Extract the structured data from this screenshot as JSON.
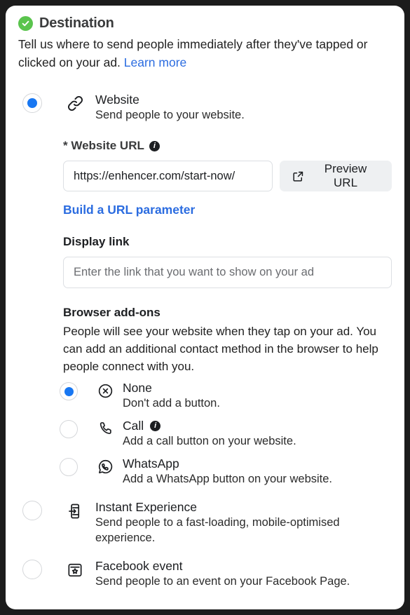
{
  "header": {
    "status_icon": "check-circle-icon",
    "status_color": "#5ac44d",
    "title": "Destination",
    "description": "Tell us where to send people immediately after they've tapped or clicked on your ad. ",
    "learn_more_label": "Learn more",
    "link_color": "#2b6ce0"
  },
  "website_option": {
    "icon": "link-icon",
    "title": "Website",
    "subtitle": "Send people to your website.",
    "selected": true
  },
  "website_url": {
    "label": "* Website URL",
    "info_icon": "info-icon",
    "value": "https://enhencer.com/start-now/",
    "placeholder": "",
    "preview_button_label": "Preview URL",
    "preview_button_icon": "external-link-icon",
    "build_parameter_label": "Build a URL parameter"
  },
  "display_link": {
    "label": "Display link",
    "placeholder": "Enter the link that you want to show on your ad",
    "value": ""
  },
  "browser_addons": {
    "label": "Browser add-ons",
    "description": "People will see your website when they tap on your ad. You can add an additional contact method in the browser to help people connect with you.",
    "options": [
      {
        "icon": "x-circle-icon",
        "title": "None",
        "subtitle": "Don't add a button.",
        "selected": true,
        "has_info": false
      },
      {
        "icon": "phone-icon",
        "title": "Call",
        "subtitle": "Add a call button on your website.",
        "selected": false,
        "has_info": true,
        "info_icon": "info-icon"
      },
      {
        "icon": "whatsapp-icon",
        "title": "WhatsApp",
        "subtitle": "Add a WhatsApp button on your website.",
        "selected": false,
        "has_info": false
      }
    ]
  },
  "other_destinations": [
    {
      "icon": "instant-experience-icon",
      "title": "Instant Experience",
      "subtitle": "Send people to a fast-loading, mobile-optimised experience.",
      "selected": false
    },
    {
      "icon": "facebook-event-icon",
      "title": "Facebook event",
      "subtitle": "Send people to an event on your Facebook Page.",
      "selected": false
    }
  ],
  "colors": {
    "accent": "#1877f2",
    "success": "#5ac44d",
    "link": "#2b6ce0",
    "button_bg": "#eef0f2"
  }
}
